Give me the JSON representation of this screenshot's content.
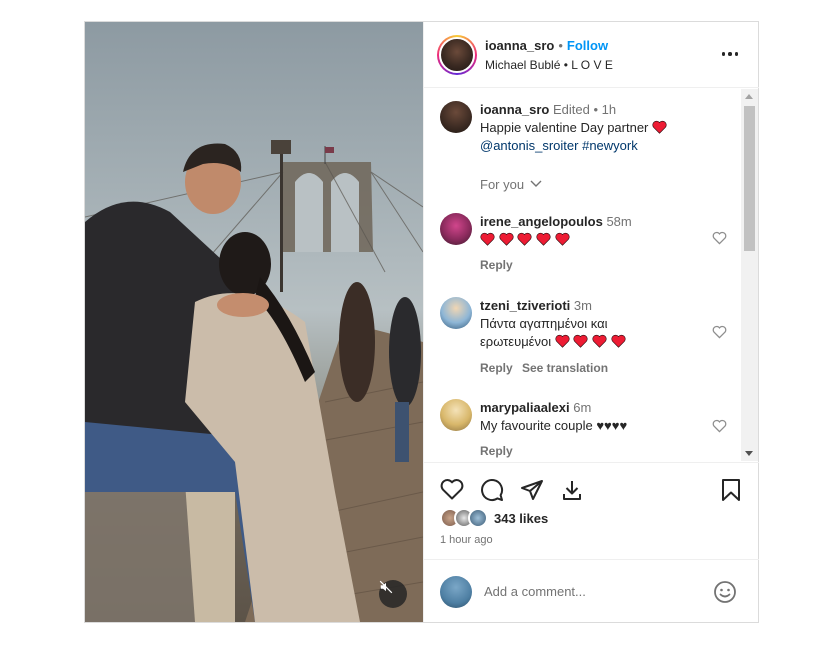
{
  "header": {
    "username": "ioanna_sro",
    "separator": "•",
    "follow_label": "Follow",
    "audio": "Michael Bublé • L O V E"
  },
  "caption": {
    "username": "ioanna_sro",
    "meta": "Edited • 1h",
    "text": "Happie valentine Day partner",
    "mention": "@antonis_sroiter",
    "hashtag": "#newyork"
  },
  "for_you": "For you",
  "comments": [
    {
      "username": "irene_angelopoulos",
      "time": "58m",
      "text": "",
      "hearts": 5,
      "reply": "Reply"
    },
    {
      "username": "tzeni_tziverioti",
      "time": "3m",
      "text_line1": "Πάντα αγαπημένοι και",
      "text_line2": "ερωτευμένοι",
      "hearts": 4,
      "reply": "Reply",
      "translation": "See translation"
    },
    {
      "username": "marypaliaalexi",
      "time": "6m",
      "text": "My favourite couple ♥♥♥♥",
      "reply": "Reply"
    }
  ],
  "likes": {
    "count_text": "343 likes"
  },
  "time_ago": "1 hour ago",
  "add_comment": {
    "placeholder": "Add a comment..."
  },
  "icons": {
    "more": "more-options-icon",
    "like": "heart-outline-icon",
    "comment": "comment-bubble-icon",
    "share": "paper-plane-icon",
    "save": "bookmark-icon",
    "download": "download-icon",
    "emoji": "emoji-smile-icon",
    "mute": "speaker-muted-icon"
  },
  "colors": {
    "accent": "#0095f6",
    "heart": "#ed1c34",
    "text": "#262626",
    "muted": "#737373"
  }
}
